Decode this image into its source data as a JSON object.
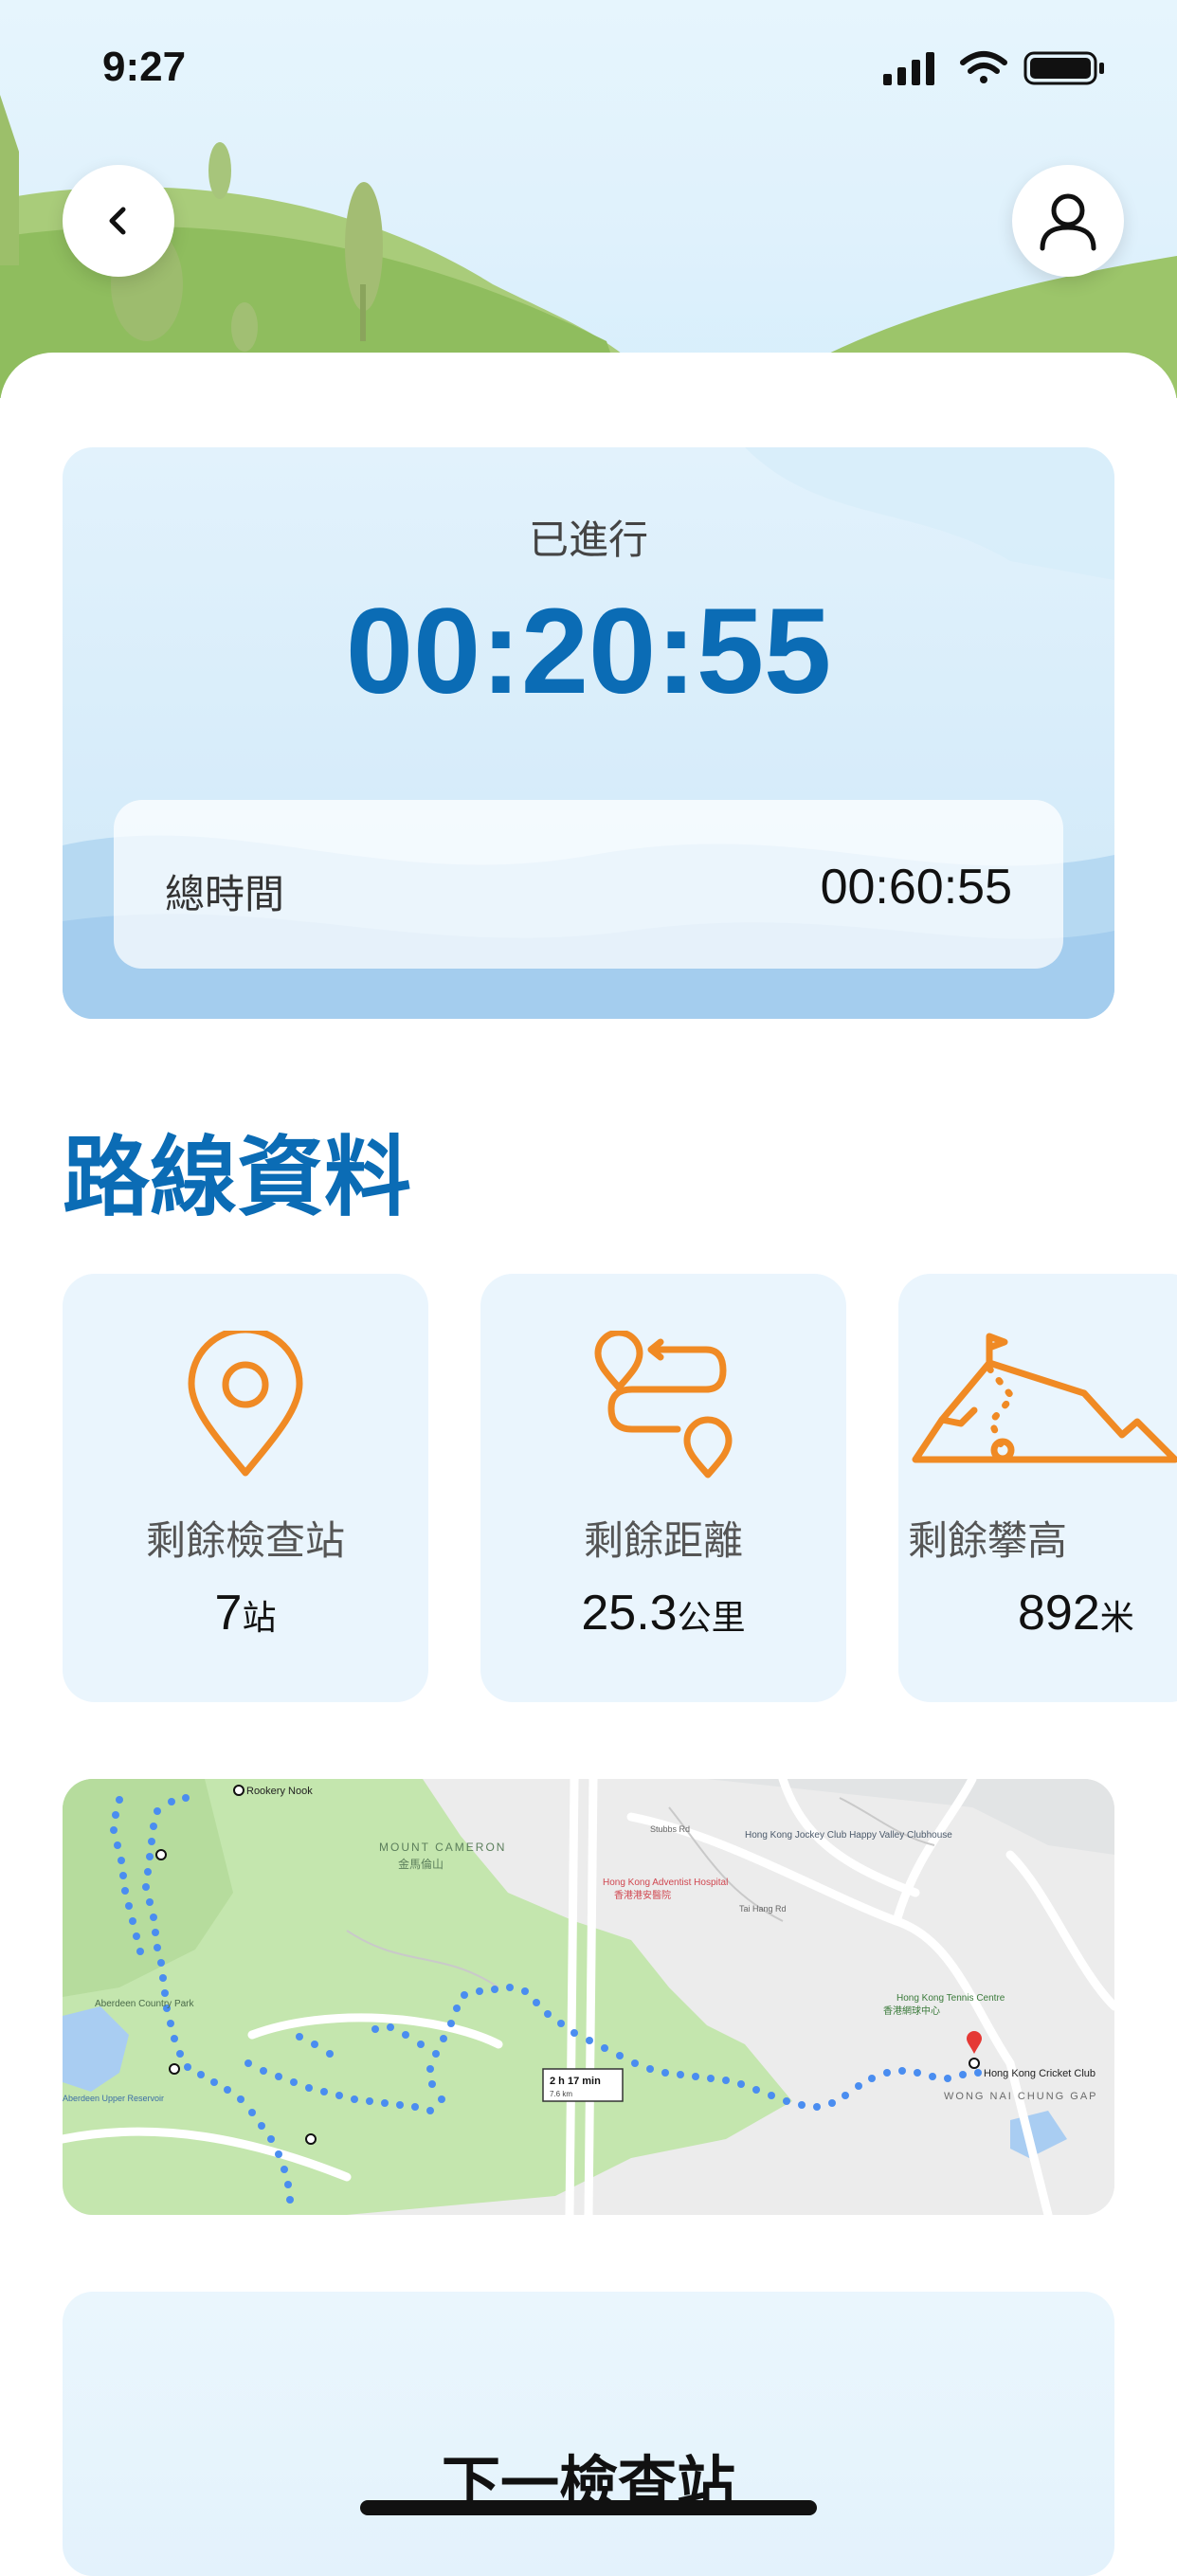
{
  "status_bar": {
    "time": "9:27"
  },
  "timer": {
    "elapsed_label": "已進行",
    "elapsed_value": "00:20:55",
    "total_label": "總時間",
    "total_value": "00:60:55"
  },
  "section_title": "路線資料",
  "stats": [
    {
      "icon": "location-pin-icon",
      "label": "剩餘檢查站",
      "value": "7",
      "unit": "站"
    },
    {
      "icon": "route-icon",
      "label": "剩餘距離",
      "value": "25.3",
      "unit": "公里"
    },
    {
      "icon": "mountain-icon",
      "label": "剩餘攀高",
      "value": "892",
      "unit": "米"
    }
  ],
  "map": {
    "places": {
      "rookery_nook": "Rookery Nook",
      "mount_cameron_en": "MOUNT CAMERON",
      "mount_cameron_zh": "金馬倫山",
      "adventist": "Hong Kong Adventist Hospital",
      "adventist_zh": "香港港安醫院",
      "jockey": "Hong Kong Jockey Club Happy Valley Clubhouse",
      "tennis": "Hong Kong Tennis Centre",
      "tennis_zh": "香港網球中心",
      "cricket": "Hong Kong Cricket Club",
      "wong_nai": "WONG NAI CHUNG GAP",
      "aberdeen": "Aberdeen Country Park",
      "reservoir": "Aberdeen Upper Reservoir",
      "tai_hang_rd": "Tai Hang Rd",
      "stubbs_rd": "Stubbs Rd",
      "route_badge": "2 h 17 min",
      "route_badge_sub": "7.6 km"
    }
  },
  "next_checkpoint_title": "下一檢查站",
  "colors": {
    "accent": "#0b6cb5",
    "icon_orange": "#f08a24",
    "route_blue": "#4a8df0"
  }
}
